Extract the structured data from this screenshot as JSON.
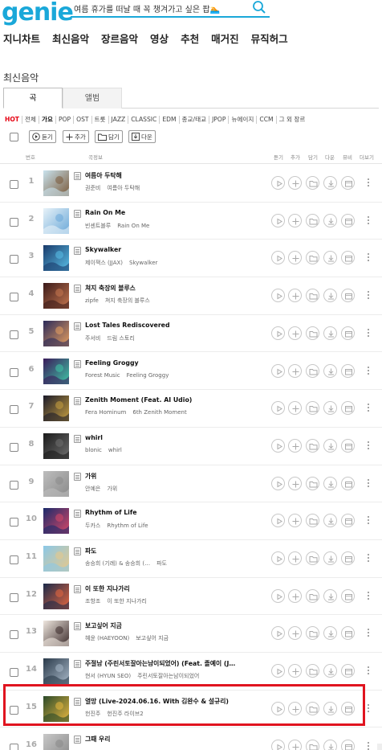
{
  "header": {
    "logo": "genie",
    "search_value": "여름 휴가를 떠날 때 꼭 챙겨가고 싶은 팝🏊",
    "brand_color": "#1aa8d9"
  },
  "gnb": [
    {
      "label": "지니차트"
    },
    {
      "label": "최신음악"
    },
    {
      "label": "장르음악"
    },
    {
      "label": "영상"
    },
    {
      "label": "추천"
    },
    {
      "label": "매거진"
    },
    {
      "label": "뮤직허그"
    }
  ],
  "page_title": "최신음악",
  "tabs": [
    {
      "label": "곡",
      "active": true
    },
    {
      "label": "앨범",
      "active": false
    }
  ],
  "genres": [
    {
      "label": "HOT",
      "style": "hot"
    },
    {
      "label": "전체",
      "style": ""
    },
    {
      "label": "가요",
      "style": "sel"
    },
    {
      "label": "POP",
      "style": ""
    },
    {
      "label": "OST",
      "style": ""
    },
    {
      "label": "트롯",
      "style": ""
    },
    {
      "label": "JAZZ",
      "style": ""
    },
    {
      "label": "CLASSIC",
      "style": ""
    },
    {
      "label": "EDM",
      "style": ""
    },
    {
      "label": "종교/태교",
      "style": ""
    },
    {
      "label": "JPOP",
      "style": ""
    },
    {
      "label": "뉴에이지",
      "style": ""
    },
    {
      "label": "CCM",
      "style": ""
    },
    {
      "label": "그 외 장르",
      "style": ""
    }
  ],
  "toolbar": {
    "listen": "듣기",
    "add": "추가",
    "put": "담기",
    "download": "다운"
  },
  "columns": {
    "number": "번호",
    "song_info": "곡정보",
    "listen": "듣기",
    "add": "추가",
    "put": "담기",
    "download": "다운",
    "mv": "뮤비",
    "more": "더보기"
  },
  "highlight_color": "#e0141f",
  "songs": [
    {
      "rank": "1",
      "title": "여름아 두탁해",
      "artist": "권준비",
      "album": "여름아 두탁해",
      "cover": [
        "#c9e3ee",
        "#7a5a3a"
      ]
    },
    {
      "rank": "2",
      "title": "Rain On Me",
      "artist": "빈센트블루",
      "album": "Rain On Me",
      "cover": [
        "#e8f2f8",
        "#6aa8d8"
      ]
    },
    {
      "rank": "3",
      "title": "Skywalker",
      "artist": "제이잭스 (JJAX)",
      "album": "Skywalker",
      "cover": [
        "#1a3a6a",
        "#5ac0e8"
      ]
    },
    {
      "rank": "4",
      "title": "쳐지 축장의 블루스",
      "artist": "zipfe",
      "album": "쳐지 축장의 블루스",
      "cover": [
        "#3a1a1a",
        "#c87850"
      ]
    },
    {
      "rank": "5",
      "title": "Lost Tales Rediscovered",
      "artist": "주서비",
      "album": "드림 스토리",
      "cover": [
        "#2a2a5a",
        "#e8a060"
      ]
    },
    {
      "rank": "6",
      "title": "Feeling Groggy",
      "artist": "Forest Music",
      "album": "Feeling Groggy",
      "cover": [
        "#3a1a5a",
        "#40c8a8"
      ]
    },
    {
      "rank": "7",
      "title": "Zenith Moment (Feat. AI Udio)",
      "artist": "Fera Hominum",
      "album": "6th Zenith Moment",
      "cover": [
        "#1a1a2a",
        "#c8a040"
      ]
    },
    {
      "rank": "8",
      "title": "whirl",
      "artist": "blonic",
      "album": "whirl",
      "cover": [
        "#1a1a1a",
        "#707070"
      ]
    },
    {
      "rank": "9",
      "title": "가위",
      "artist": "안예은",
      "album": "가위",
      "cover": [
        "#bdbdbd",
        "#8a8a8a"
      ]
    },
    {
      "rank": "10",
      "title": "Rhythm of Life",
      "artist": "두카스",
      "album": "Rhythm of Life",
      "cover": [
        "#1a2a6a",
        "#d84868"
      ]
    },
    {
      "rank": "11",
      "title": "파도",
      "artist": "송승희 (기례) & 송승희 (…",
      "album": "파도",
      "cover": [
        "#8ac8e8",
        "#e8c888"
      ]
    },
    {
      "rank": "12",
      "title": "이 또한 지나가리",
      "artist": "조항조",
      "album": "이 또한 지나가리",
      "cover": [
        "#1a2a4a",
        "#e86840"
      ]
    },
    {
      "rank": "13",
      "title": "보고싶어 지금",
      "artist": "혜윤 (HAEYOON)",
      "album": "보고싶어 지금",
      "cover": [
        "#f0e8e0",
        "#3a2a2a"
      ]
    },
    {
      "rank": "14",
      "title": "주절남 (주린서토잘아는남이되었어) (Feat. 졸예이 (J…",
      "artist": "현서 (HYUN SEO)",
      "album": "주린서토잘아는남이되었어",
      "cover": [
        "#2a3a4a",
        "#a8b8c8"
      ]
    },
    {
      "rank": "15",
      "title": "열망 (Live-2024.06.16. With 김완수 & 설규리)",
      "artist": "헌진주",
      "album": "헌진주 라이브2",
      "cover": [
        "#2a4a2a",
        "#e8b840"
      ]
    },
    {
      "rank": "16",
      "title": "그때 우리",
      "artist": "",
      "album": "",
      "cover": [
        "#c8c8c8",
        "#888888"
      ]
    }
  ]
}
